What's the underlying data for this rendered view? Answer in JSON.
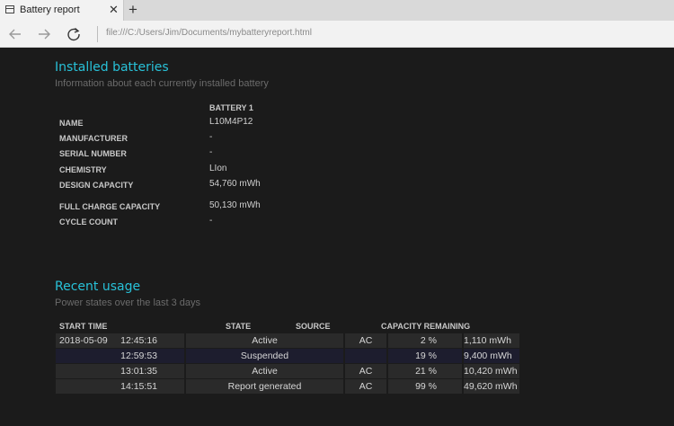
{
  "browser": {
    "tab_title": "Battery report",
    "tab_close": "✕",
    "new_tab": "+",
    "address": "file:///C:/Users/Jim/Documents/mybatteryreport.html"
  },
  "installed": {
    "title": "Installed batteries",
    "subtitle": "Information about each currently installed battery",
    "battery_header": "BATTERY 1",
    "rows": [
      {
        "label": "NAME",
        "value": "L10M4P12"
      },
      {
        "label": "MANUFACTURER",
        "value": "-"
      },
      {
        "label": "SERIAL NUMBER",
        "value": "-"
      },
      {
        "label": "CHEMISTRY",
        "value": "LIon"
      },
      {
        "label": "DESIGN CAPACITY",
        "value": "54,760 mWh"
      },
      {
        "label": "FULL CHARGE CAPACITY",
        "value": "50,130 mWh"
      },
      {
        "label": "CYCLE COUNT",
        "value": "-"
      }
    ]
  },
  "usage": {
    "title": "Recent usage",
    "subtitle": "Power states over the last 3 days",
    "columns": {
      "start_time": "START TIME",
      "state": "STATE",
      "source": "SOURCE",
      "capacity": "CAPACITY REMAINING"
    },
    "rows": [
      {
        "date": "2018-05-09",
        "time": "12:45:16",
        "state": "Active",
        "source": "AC",
        "percent": "2 %",
        "mwh": "1,110 mWh"
      },
      {
        "date": "",
        "time": "12:59:53",
        "state": "Suspended",
        "source": "",
        "percent": "19 %",
        "mwh": "9,400 mWh"
      },
      {
        "date": "",
        "time": "13:01:35",
        "state": "Active",
        "source": "AC",
        "percent": "21 %",
        "mwh": "10,420 mWh"
      },
      {
        "date": "",
        "time": "14:15:51",
        "state": "Report generated",
        "source": "AC",
        "percent": "99 %",
        "mwh": "49,620 mWh"
      }
    ]
  }
}
